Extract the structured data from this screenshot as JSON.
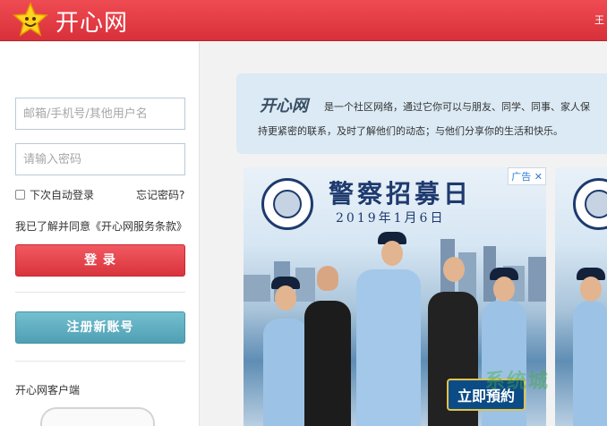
{
  "header": {
    "logo_icon": "smiling-star-icon",
    "logo_text": "开心网",
    "top_right_text": "王"
  },
  "login": {
    "username_placeholder": "邮箱/手机号/其他用户名",
    "password_placeholder": "请输入密码",
    "remember_label": "下次自动登录",
    "forgot_label": "忘记密码?",
    "terms_text": "我已了解并同意《开心网服务条款》",
    "login_button": "登 录",
    "register_button": "注册新账号",
    "client_label": "开心网客户端"
  },
  "intro": {
    "brand": "开心网",
    "line1": "是一个社区网络，通过它你可以与朋友、同学、同事、家人保",
    "line2": "持更紧密的联系，及时了解他们的动态；与他们分享你的生活和快乐。"
  },
  "ad": {
    "title": "警察招募日",
    "date": "2019年1月6日",
    "badge": "广告",
    "close_icon": "close-icon",
    "cta": "立即預約"
  },
  "watermark": "系统城",
  "colors": {
    "header_red": "#e03c44",
    "login_red": "#e24049",
    "register_teal": "#5aaabd",
    "intro_bg": "#dbeaf4"
  }
}
